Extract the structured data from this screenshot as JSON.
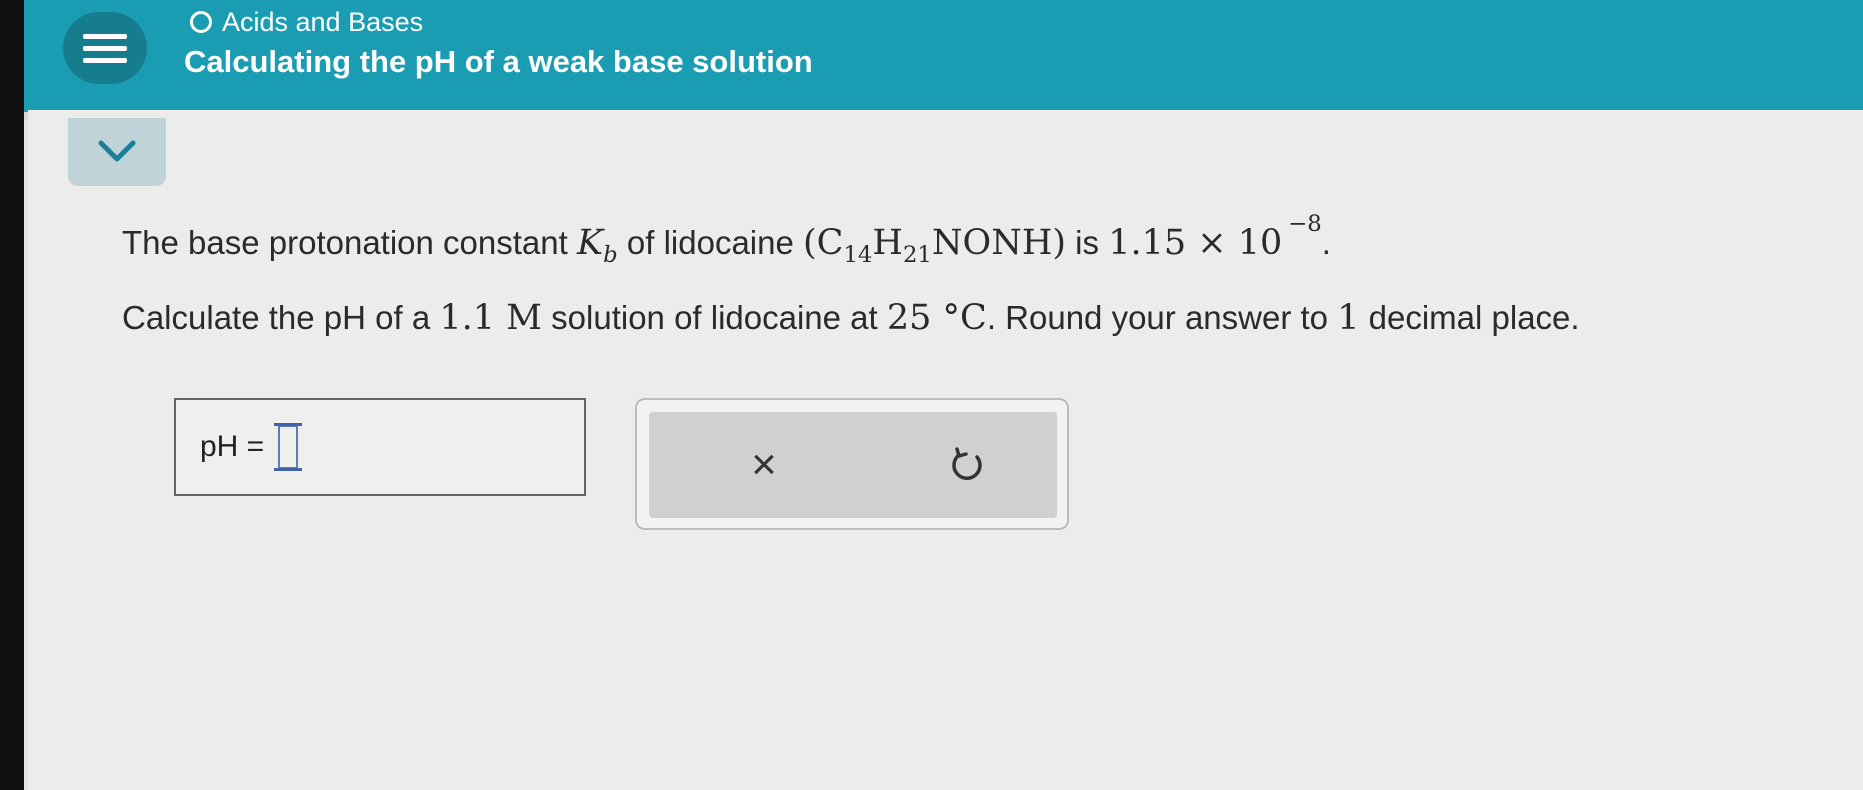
{
  "header": {
    "breadcrumb": "Acids and Bases",
    "title": "Calculating the pH of a weak base solution"
  },
  "problem": {
    "line1_a": "The base protonation constant ",
    "k_symbol": "K",
    "k_sub": "b",
    "line1_b": " of lidocaine ",
    "formula_open": "(C",
    "c_sub": "14",
    "formula_h": "H",
    "h_sub": "21",
    "formula_close": "NONH)",
    "line1_c": " is ",
    "kb_mantissa": "1.15 × 10",
    "kb_exponent": "−8",
    "line1_end": ".",
    "line2_a": "Calculate the pH of a ",
    "concentration": "1.1 M",
    "line2_b": " solution of lidocaine at ",
    "temperature": "25 °C",
    "line2_c": ". Round your answer to ",
    "decimals": "1",
    "line2_d": " decimal place."
  },
  "answer": {
    "label": "pH ="
  },
  "tools": {
    "clear_glyph": "×",
    "undo_glyph": "↺"
  },
  "colors": {
    "header_bg": "#1a9db2",
    "menu_bg": "#167d8f",
    "tab_bg": "#bfd3d8"
  }
}
